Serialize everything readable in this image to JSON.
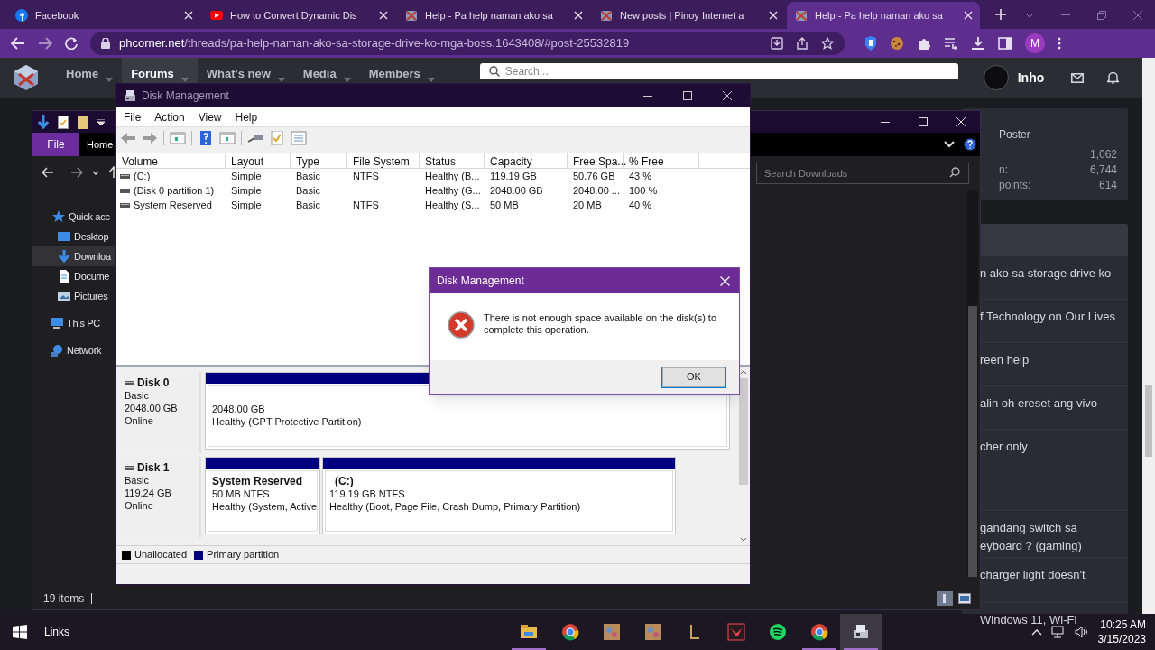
{
  "browser": {
    "tabs": [
      {
        "title": "Facebook",
        "selected": false
      },
      {
        "title": "How to Convert Dynamic Dis",
        "selected": false
      },
      {
        "title": "Help - Pa help naman ako sa",
        "selected": false
      },
      {
        "title": "New posts | Pinoy Internet a",
        "selected": false
      },
      {
        "title": "Help - Pa help naman ako sa",
        "selected": true
      }
    ],
    "address": {
      "domain": "phcorner.net",
      "path": "/threads/pa-help-naman-ako-sa-storage-drive-ko-mga-boss.1643408/#post-25532819"
    },
    "profile_initial": "M"
  },
  "forum": {
    "nav": [
      {
        "label": "Home",
        "selected": false
      },
      {
        "label": "Forums",
        "selected": true
      },
      {
        "label": "What's new",
        "selected": false
      },
      {
        "label": "Media",
        "selected": false
      },
      {
        "label": "Members",
        "selected": false
      }
    ],
    "search_placeholder": "Search...",
    "user": "Inho",
    "poster": {
      "title": "Poster",
      "stats": [
        {
          "value": "1,062"
        },
        {
          "label": "n:",
          "value": "6,744"
        },
        {
          "label": "points:",
          "value": "614"
        }
      ]
    },
    "threads": [
      {
        "lines": [
          "n ako sa storage drive ko"
        ]
      },
      {
        "lines": [
          "f Technology on Our Lives"
        ]
      },
      {
        "lines": [
          "reen help"
        ]
      },
      {
        "lines": [
          "alin oh ereset ang vivo"
        ]
      },
      {
        "lines": [
          "cher only"
        ]
      },
      {
        "lines": [
          "gandang switch sa",
          "eyboard ? (gaming)"
        ]
      },
      {
        "lines": [
          "charger light doesn't"
        ]
      },
      {
        "lines": [
          "Windows 11, Wi-Fi"
        ]
      }
    ]
  },
  "explorer": {
    "ribbon_tabs": [
      {
        "label": "File",
        "selected": true
      },
      {
        "label": "Home",
        "selected": false
      }
    ],
    "search_placeholder": "Search Downloads",
    "nav": [
      {
        "label": "Quick acc",
        "selected": false
      },
      {
        "label": "Desktop",
        "selected": false
      },
      {
        "label": "Downloa",
        "selected": true
      },
      {
        "label": "Docume",
        "selected": false
      },
      {
        "label": "Pictures",
        "selected": false
      },
      {
        "label": "This PC",
        "selected": false
      },
      {
        "label": "Network",
        "selected": false
      }
    ],
    "status": "19 items"
  },
  "disk_management": {
    "title": "Disk Management",
    "menu": [
      "File",
      "Action",
      "View",
      "Help"
    ],
    "columns": [
      "Volume",
      "Layout",
      "Type",
      "File System",
      "Status",
      "Capacity",
      "Free Spa...",
      "% Free"
    ],
    "rows": [
      {
        "volume": "(C:)",
        "layout": "Simple",
        "type": "Basic",
        "file_system": "NTFS",
        "status": "Healthy (B...",
        "capacity": "119.19 GB",
        "free_space": "50.76 GB",
        "percent_free": "43 %"
      },
      {
        "volume": "(Disk 0 partition 1)",
        "layout": "Simple",
        "type": "Basic",
        "status": "Healthy (G...",
        "capacity": "2048.00 GB",
        "free_space": "2048.00 ...",
        "percent_free": "100 %"
      },
      {
        "volume": "System Reserved",
        "layout": "Simple",
        "type": "Basic",
        "file_system": "NTFS",
        "status": "Healthy (S...",
        "capacity": "50 MB",
        "free_space": "20 MB",
        "percent_free": "40 %"
      }
    ],
    "disks": [
      {
        "name": "Disk 0",
        "type": "Basic",
        "size": "2048.00 GB",
        "state": "Online",
        "partitions": [
          {
            "kind": "primary",
            "size": "2048.00 GB",
            "health": "Healthy (GPT Protective Partition)"
          }
        ]
      },
      {
        "name": "Disk 1",
        "type": "Basic",
        "size": "119.24 GB",
        "state": "Online",
        "partitions": [
          {
            "kind": "primary",
            "name": "System Reserved",
            "size": "50 MB NTFS",
            "health": "Healthy (System, Active"
          },
          {
            "kind": "primary",
            "name": "(C:)",
            "size": "119.19 GB NTFS",
            "health": "Healthy (Boot, Page File, Crash Dump, Primary Partition)"
          }
        ]
      }
    ],
    "legend": [
      {
        "label": "Unallocated",
        "color": "#000000"
      },
      {
        "label": "Primary partition",
        "color": "#000080"
      }
    ]
  },
  "dialog": {
    "title": "Disk Management",
    "message": "There is not enough space available on the disk(s) to complete this operation.",
    "button": "OK"
  },
  "taskbar": {
    "toolbar_label": "Links",
    "apps": [
      {
        "kind": "folder",
        "running": true,
        "selected": false
      },
      {
        "kind": "chrome",
        "running": false,
        "selected": false
      },
      {
        "kind": "game",
        "running": false,
        "selected": false
      },
      {
        "kind": "game",
        "running": false,
        "selected": false
      },
      {
        "kind": "league",
        "running": false,
        "selected": false
      },
      {
        "kind": "valorant",
        "running": false,
        "selected": false
      },
      {
        "kind": "spotify",
        "running": false,
        "selected": false
      },
      {
        "kind": "chrome",
        "running": true,
        "selected": false
      },
      {
        "kind": "disk",
        "running": true,
        "selected": true
      }
    ],
    "time": "10:25 AM",
    "date": "3/15/2023"
  }
}
